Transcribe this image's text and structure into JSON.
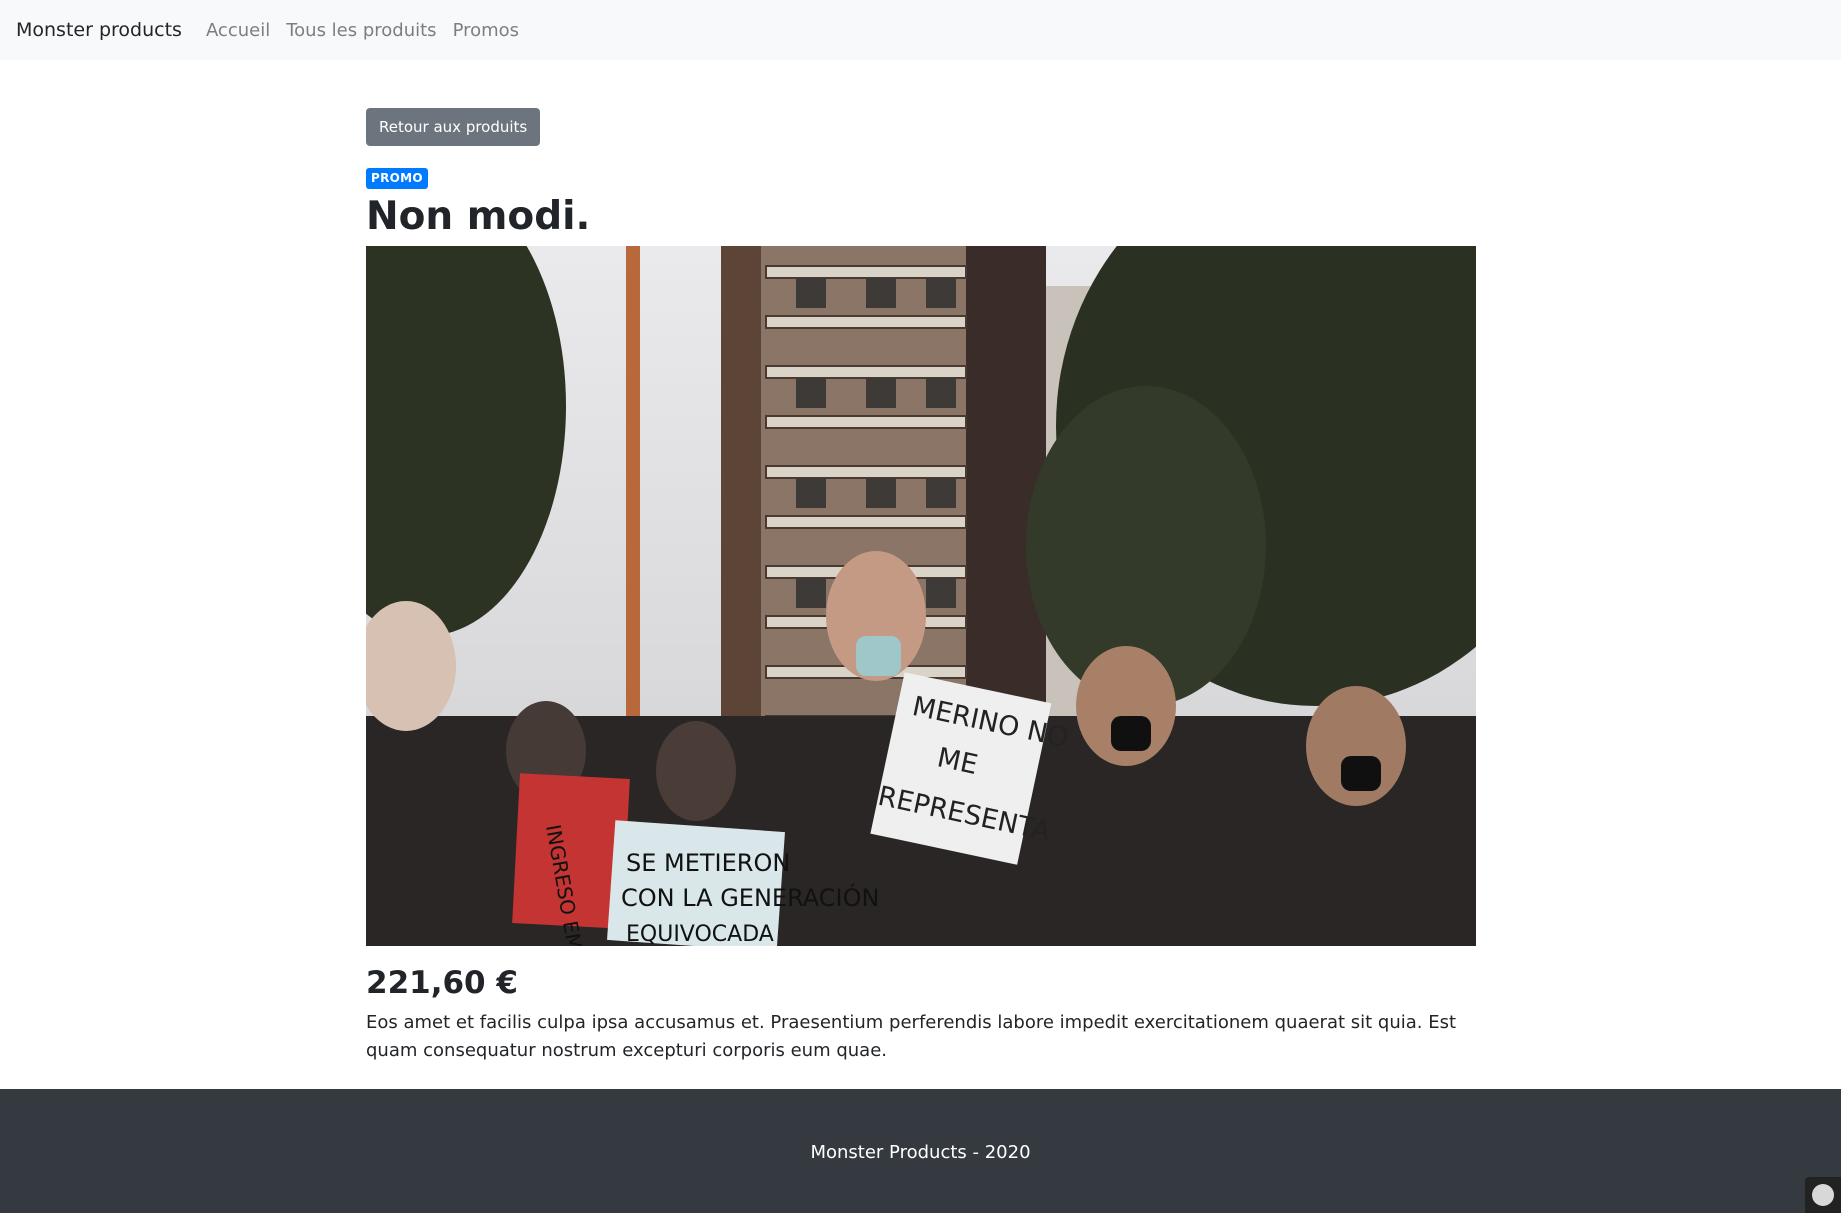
{
  "navbar": {
    "brand": "Monster products",
    "links": [
      "Accueil",
      "Tous les produits",
      "Promos"
    ]
  },
  "product": {
    "back_label": "Retour aux produits",
    "badge": "PROMO",
    "title": "Non modi.",
    "price": "221,60 €",
    "description": "Eos amet et facilis culpa ipsa accusamus et. Praesentium perferendis labore impedit exercitationem quaerat sit quia. Est quam consequatur nostrum excepturi corporis eum quae.",
    "image_signs": {
      "left": "INGRESO\nEMPRESA",
      "middle": "SE METIERON\nCON LA GENERACIÓN\nEQUIVOCADA",
      "main": "MERINO NO\nME\nREPRESENTA"
    }
  },
  "footer": {
    "text": "Monster Products - 2020"
  },
  "colors": {
    "navbar_bg": "#f8f9fa",
    "button_bg": "#6c757d",
    "badge_bg": "#007bff",
    "footer_bg": "#343a40"
  },
  "icons": {
    "toolbar": "symfony-icon"
  }
}
